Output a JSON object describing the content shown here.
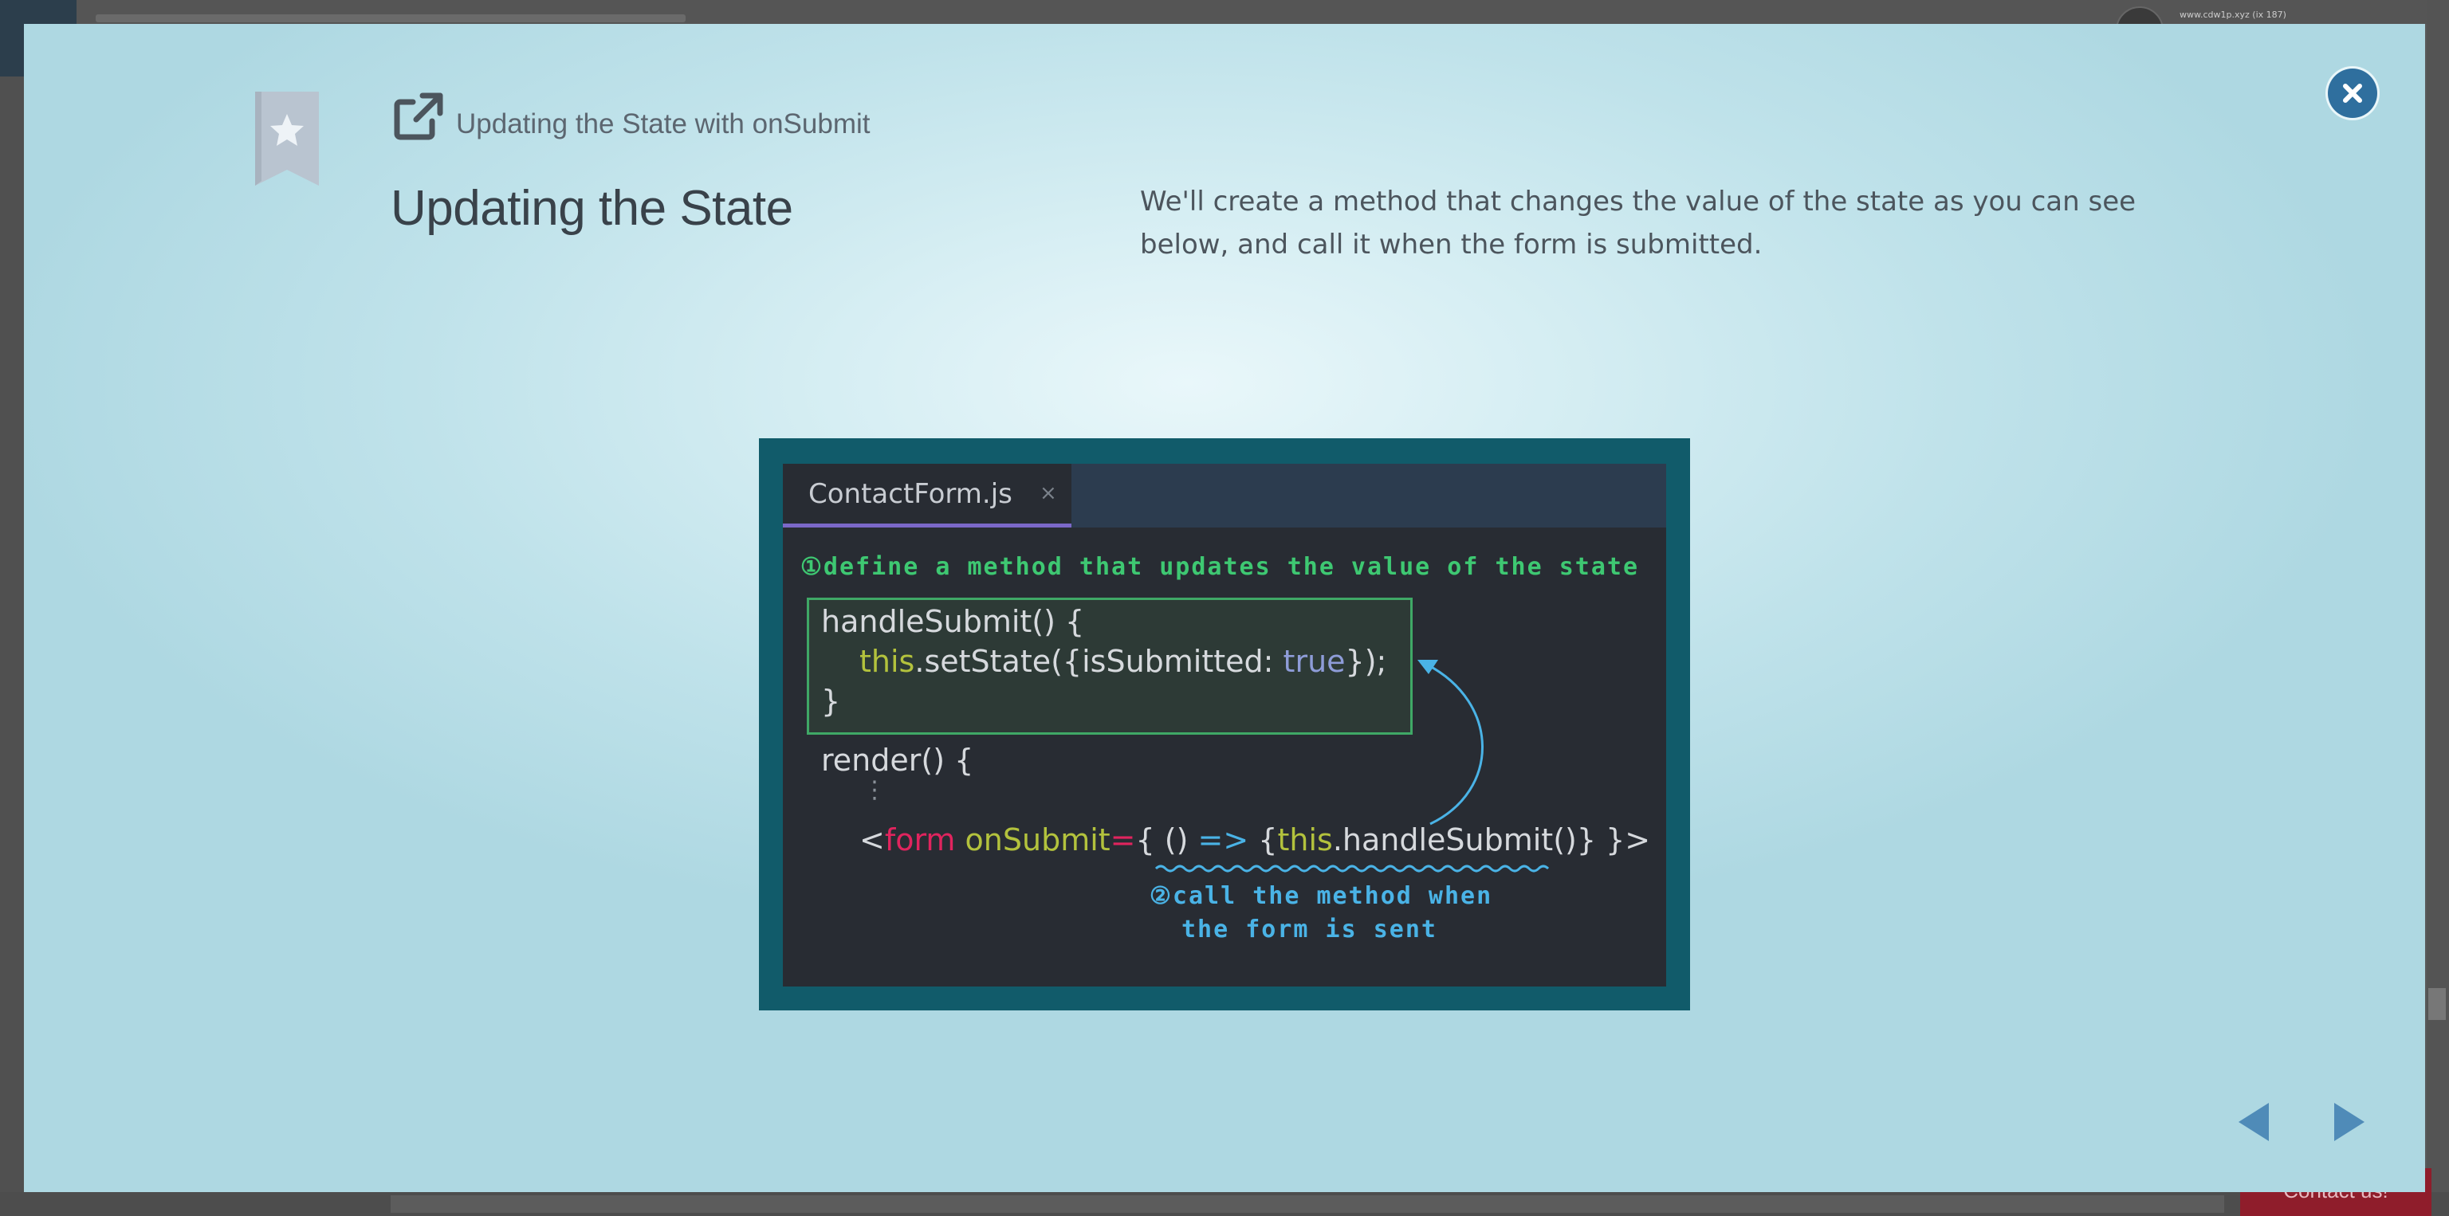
{
  "background": {
    "user_text": "www.cdw1p.xyz (ix 187)",
    "contact_label": "Contact us!"
  },
  "modal": {
    "breadcrumb": "Updating the State with onSubmit",
    "title": "Updating the State",
    "description": "We'll create a method that changes the value of the state as you can see below, and call it when the form is submitted.",
    "icons": {
      "close": "close-icon",
      "bookmark": "bookmark-star-icon",
      "external": "external-link-icon",
      "prev": "prev-arrow-icon",
      "next": "next-arrow-icon"
    },
    "colors": {
      "accent": "#2f6f9e",
      "nav_arrow": "#4f8bb8"
    }
  },
  "illustration": {
    "tab_name": "ContactForm.js",
    "tab_close": "×",
    "note1_num": "①",
    "note1": "define a method that updates the value of the state",
    "code": {
      "line1": "handleSubmit() {",
      "line2_this": "this",
      "line2_dot": ".",
      "line2_call": "setState({isSubmitted: ",
      "line2_bool": "true",
      "line2_end": "});",
      "line3": "}",
      "line4": "render() {",
      "line5": "⋮",
      "line6_open": "<",
      "line6_tag": "form",
      "line6_attr": " onSubmit",
      "line6_eq": "=",
      "line6_brace": "{ () ",
      "line6_arrow": "=>",
      "line6_brace2": " {",
      "line6_this": "this",
      "line6_rest": ".handleSubmit()} }>"
    },
    "note2_num": "②",
    "note2_line1": "call the method when",
    "note2_line2": "the form is sent"
  }
}
